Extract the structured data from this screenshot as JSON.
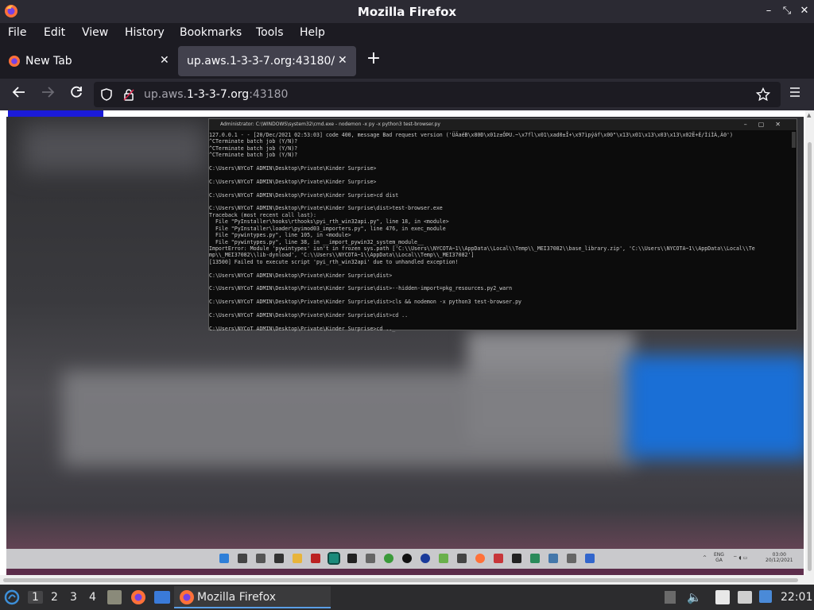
{
  "window": {
    "title": "Mozilla Firefox",
    "controls": {
      "minimize": "–",
      "maximize": "⤡",
      "close": "✕"
    }
  },
  "menubar": [
    "File",
    "Edit",
    "View",
    "History",
    "Bookmarks",
    "Tools",
    "Help"
  ],
  "tabs": [
    {
      "label": "New Tab",
      "active": false
    },
    {
      "label": "up.aws.1-3-3-7.org:43180/",
      "active": true
    }
  ],
  "navbar": {
    "url_prefix": "up.aws.",
    "url_host": "1-3-3-7.org",
    "url_port": ":43180",
    "icons": [
      "back-icon",
      "forward-icon",
      "reload-icon",
      "shield-icon",
      "lock-icon",
      "star-icon",
      "menu-icon"
    ]
  },
  "cmd": {
    "title": "Administrator: C:\\WINDOWS\\system32\\cmd.exe - nodemon -x py -x python3 test-browser.py",
    "lines": [
      "127.0.0.1 - - [20/Dec/2021 02:53:03] code 400, message Bad request version ('ÜÄaéB\\x80Ð\\x01z±ÓÞU.~\\x7fl\\x01\\xad0±Î+\\x97ìpýáf\\x00\"\\x13\\x01\\x13\\x03\\x13\\x02Ë+È/ÌíÌÀ,À0')",
      "^CTerminate batch job (Y/N)?",
      "^CTerminate batch job (Y/N)?",
      "^CTerminate batch job (Y/N)?",
      "",
      "C:\\Users\\NYCoT ADMIN\\Desktop\\Private\\Kinder Surprise>",
      "",
      "C:\\Users\\NYCoT ADMIN\\Desktop\\Private\\Kinder Surprise>",
      "",
      "C:\\Users\\NYCoT ADMIN\\Desktop\\Private\\Kinder Surprise>cd dist",
      "",
      "C:\\Users\\NYCoT ADMIN\\Desktop\\Private\\Kinder Surprise\\dist>test-browser.exe",
      "Traceback (most recent call last):",
      "  File \"PyInstaller\\hooks\\rthooks\\pyi_rth_win32api.py\", line 18, in <module>",
      "  File \"PyInstaller\\loader\\pyimod03_importers.py\", line 476, in exec_module",
      "  File \"pywintypes.py\", line 105, in <module>",
      "  File \"pywintypes.py\", line 38, in __import_pywin32_system_module__",
      "ImportError: Module 'pywintypes' isn't in frozen sys.path ['C:\\\\Users\\\\NYCOTA~1\\\\AppData\\\\Local\\\\Temp\\\\_MEI37082\\\\base_library.zip', 'C:\\\\Users\\\\NYCOTA~1\\\\AppData\\\\Local\\\\Te",
      "mp\\\\_MEI37082\\\\lib-dynload', 'C:\\\\Users\\\\NYCOTA~1\\\\AppData\\\\Local\\\\Temp\\\\_MEI37082']",
      "[13500] Failed to execute script 'pyi_rth_win32api' due to unhandled exception!",
      "",
      "C:\\Users\\NYCoT ADMIN\\Desktop\\Private\\Kinder Surprise\\dist>",
      "",
      "C:\\Users\\NYCoT ADMIN\\Desktop\\Private\\Kinder Surprise\\dist>--hidden-import=pkg_resources.py2_warn",
      "",
      "C:\\Users\\NYCoT ADMIN\\Desktop\\Private\\Kinder Surprise\\dist>cls && nodemon -x python3 test-browser.py",
      "",
      "C:\\Users\\NYCoT ADMIN\\Desktop\\Private\\Kinder Surprise\\dist>cd ..",
      "",
      "C:\\Users\\NYCoT ADMIN\\Desktop\\Private\\Kinder Surprise>cd .._"
    ]
  },
  "win_taskbar": {
    "lang_top": "ENG",
    "lang_bottom": "GA",
    "time": "03:00",
    "date": "20/12/2021"
  },
  "panel": {
    "workspaces": [
      "1",
      "2",
      "3",
      "4"
    ],
    "active_workspace": "1",
    "task_label": "Mozilla Firefox",
    "clock": "22:01"
  },
  "colors": {
    "chrome_dark": "#1c1b22",
    "chrome_mid": "#2b2a33",
    "tab_active": "#42414d",
    "page_blue": "#1b1bd9"
  }
}
